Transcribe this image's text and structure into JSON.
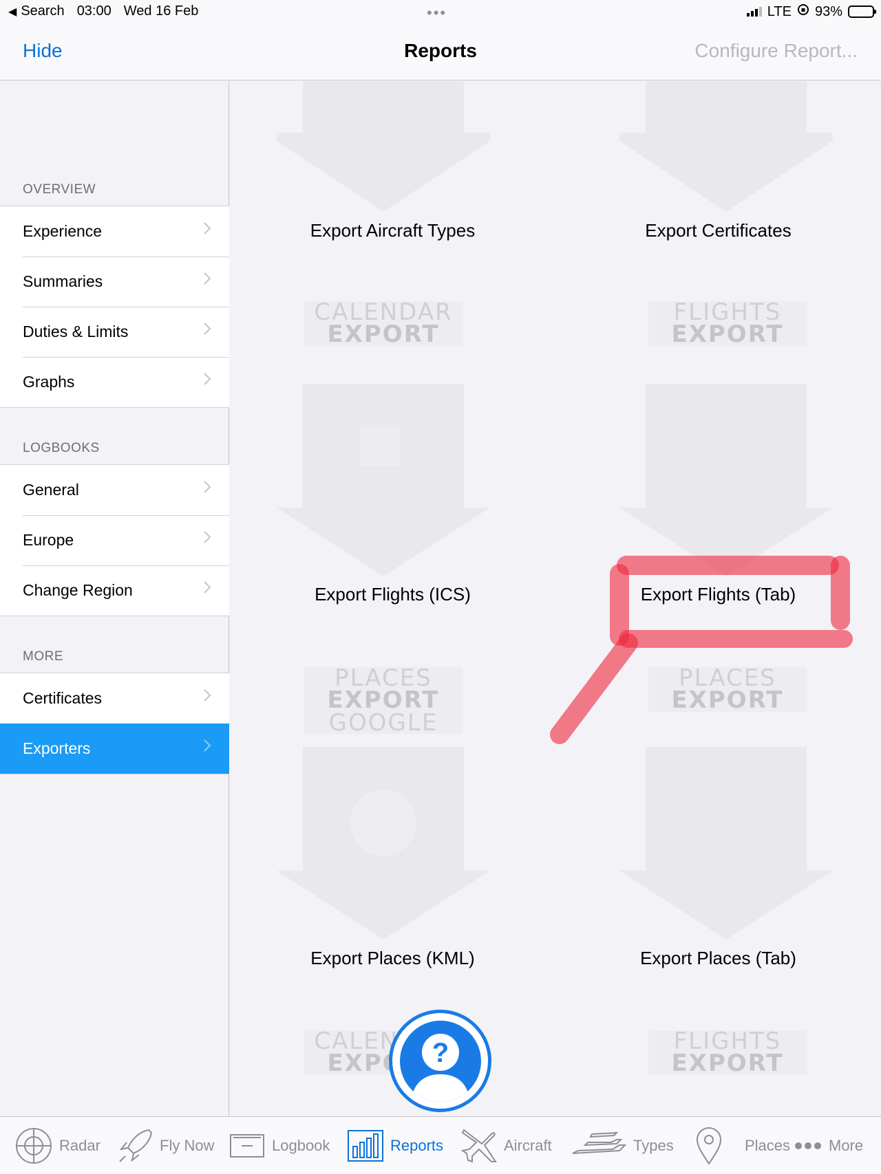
{
  "status_bar": {
    "back_app": "Search",
    "time": "03:00",
    "date": "Wed 16 Feb",
    "multitask_dots": "•••",
    "network": "LTE",
    "battery_percent": "93%",
    "battery_level": 0.93
  },
  "nav": {
    "left_button": "Hide",
    "title": "Reports",
    "right_button": "Configure Report..."
  },
  "sidebar": {
    "sections": [
      {
        "header": "OVERVIEW",
        "items": [
          {
            "label": "Experience"
          },
          {
            "label": "Summaries"
          },
          {
            "label": "Duties & Limits"
          },
          {
            "label": "Graphs"
          }
        ]
      },
      {
        "header": "LOGBOOKS",
        "items": [
          {
            "label": "General"
          },
          {
            "label": "Europe"
          },
          {
            "label": "Change Region"
          }
        ]
      },
      {
        "header": "MORE",
        "items": [
          {
            "label": "Certificates"
          },
          {
            "label": "Exporters",
            "selected": true
          }
        ]
      }
    ]
  },
  "exporters": [
    {
      "label": "Export Aircraft Types",
      "badge": []
    },
    {
      "label": "Export Certificates",
      "badge": []
    },
    {
      "label": "Export Flights (ICS)",
      "badge": [
        "CALENDAR",
        "EXPORT"
      ]
    },
    {
      "label": "Export Flights (Tab)",
      "badge": [
        "FLIGHTS",
        "EXPORT"
      ],
      "highlighted": true
    },
    {
      "label": "Export Places (KML)",
      "badge": [
        "PLACES",
        "EXPORT",
        "GOOGLE"
      ]
    },
    {
      "label": "Export Places (Tab)",
      "badge": [
        "PLACES",
        "EXPORT"
      ]
    },
    {
      "label": "",
      "badge": [
        "CALENDAR",
        "EXPORT"
      ]
    },
    {
      "label": "",
      "badge": [
        "FLIGHTS",
        "EXPORT"
      ]
    }
  ],
  "annotation_color": "#f0283c",
  "help_button_icon": "help-person-icon",
  "tab_bar": {
    "tabs": [
      {
        "label": "Radar",
        "icon": "radar-icon"
      },
      {
        "label": "Fly Now",
        "icon": "rocket-icon"
      },
      {
        "label": "Logbook",
        "icon": "logbook-icon"
      },
      {
        "label": "Reports",
        "icon": "bar-chart-icon",
        "active": true
      },
      {
        "label": "Aircraft",
        "icon": "airplane-icon"
      },
      {
        "label": "Types",
        "icon": "aircraft-types-icon"
      },
      {
        "label": "Places",
        "icon": "location-pin-icon"
      },
      {
        "label": "More",
        "icon": "more-dots-icon"
      }
    ]
  }
}
